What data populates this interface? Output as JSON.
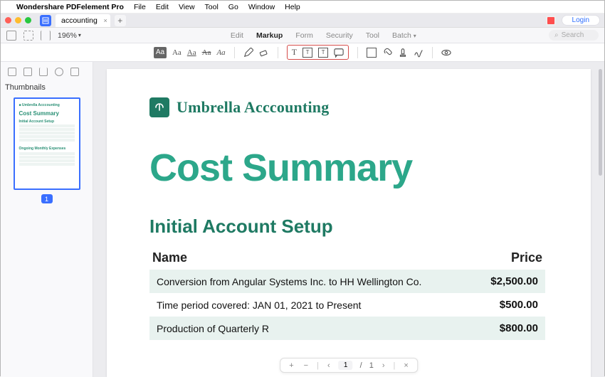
{
  "app": {
    "name": "Wondershare PDFelement Pro",
    "menus": [
      "File",
      "Edit",
      "View",
      "Tool",
      "Go",
      "Window",
      "Help"
    ]
  },
  "tabs": {
    "active_tab": "accounting",
    "login_label": "Login"
  },
  "toolbar": {
    "zoom": "196%",
    "mode_tabs": [
      "Edit",
      "Markup",
      "Form",
      "Security",
      "Tool",
      "Batch"
    ],
    "active_mode": "Markup",
    "search_placeholder": "Search"
  },
  "sidebar": {
    "title": "Thumbnails",
    "page_number": "1"
  },
  "document": {
    "brand": "Umbrella Acccounting",
    "title": "Cost Summary",
    "section1": {
      "heading": "Initial Account Setup",
      "col_name": "Name",
      "col_price": "Price",
      "rows": [
        {
          "name": "Conversion from Angular Systems Inc. to HH Wellington Co.",
          "price": "$2,500.00"
        },
        {
          "name": "Time period covered: JAN 01, 2021 to Present",
          "price": "$500.00"
        },
        {
          "name": "Production of Quarterly R",
          "price": "$800.00"
        }
      ]
    }
  },
  "page_nav": {
    "current": "1",
    "total": "1"
  }
}
